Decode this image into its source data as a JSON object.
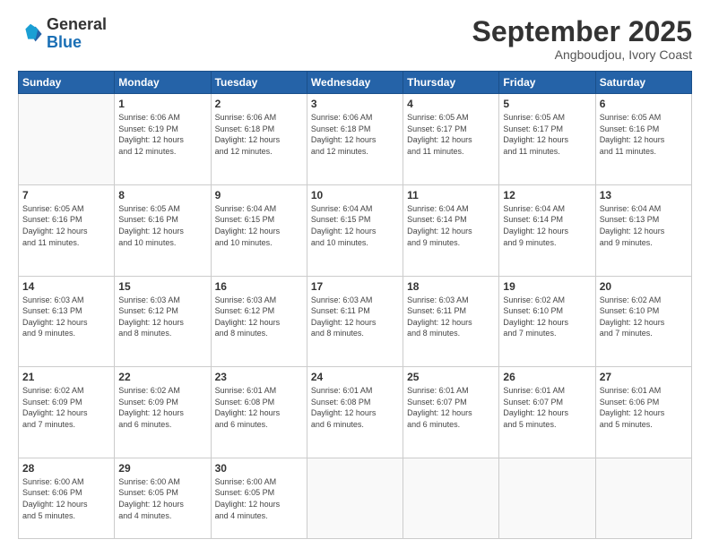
{
  "logo": {
    "general": "General",
    "blue": "Blue"
  },
  "header": {
    "month": "September 2025",
    "location": "Angboudjou, Ivory Coast"
  },
  "weekdays": [
    "Sunday",
    "Monday",
    "Tuesday",
    "Wednesday",
    "Thursday",
    "Friday",
    "Saturday"
  ],
  "weeks": [
    [
      {
        "day": "",
        "info": ""
      },
      {
        "day": "1",
        "info": "Sunrise: 6:06 AM\nSunset: 6:19 PM\nDaylight: 12 hours\nand 12 minutes."
      },
      {
        "day": "2",
        "info": "Sunrise: 6:06 AM\nSunset: 6:18 PM\nDaylight: 12 hours\nand 12 minutes."
      },
      {
        "day": "3",
        "info": "Sunrise: 6:06 AM\nSunset: 6:18 PM\nDaylight: 12 hours\nand 12 minutes."
      },
      {
        "day": "4",
        "info": "Sunrise: 6:05 AM\nSunset: 6:17 PM\nDaylight: 12 hours\nand 11 minutes."
      },
      {
        "day": "5",
        "info": "Sunrise: 6:05 AM\nSunset: 6:17 PM\nDaylight: 12 hours\nand 11 minutes."
      },
      {
        "day": "6",
        "info": "Sunrise: 6:05 AM\nSunset: 6:16 PM\nDaylight: 12 hours\nand 11 minutes."
      }
    ],
    [
      {
        "day": "7",
        "info": "Sunrise: 6:05 AM\nSunset: 6:16 PM\nDaylight: 12 hours\nand 11 minutes."
      },
      {
        "day": "8",
        "info": "Sunrise: 6:05 AM\nSunset: 6:16 PM\nDaylight: 12 hours\nand 10 minutes."
      },
      {
        "day": "9",
        "info": "Sunrise: 6:04 AM\nSunset: 6:15 PM\nDaylight: 12 hours\nand 10 minutes."
      },
      {
        "day": "10",
        "info": "Sunrise: 6:04 AM\nSunset: 6:15 PM\nDaylight: 12 hours\nand 10 minutes."
      },
      {
        "day": "11",
        "info": "Sunrise: 6:04 AM\nSunset: 6:14 PM\nDaylight: 12 hours\nand 9 minutes."
      },
      {
        "day": "12",
        "info": "Sunrise: 6:04 AM\nSunset: 6:14 PM\nDaylight: 12 hours\nand 9 minutes."
      },
      {
        "day": "13",
        "info": "Sunrise: 6:04 AM\nSunset: 6:13 PM\nDaylight: 12 hours\nand 9 minutes."
      }
    ],
    [
      {
        "day": "14",
        "info": "Sunrise: 6:03 AM\nSunset: 6:13 PM\nDaylight: 12 hours\nand 9 minutes."
      },
      {
        "day": "15",
        "info": "Sunrise: 6:03 AM\nSunset: 6:12 PM\nDaylight: 12 hours\nand 8 minutes."
      },
      {
        "day": "16",
        "info": "Sunrise: 6:03 AM\nSunset: 6:12 PM\nDaylight: 12 hours\nand 8 minutes."
      },
      {
        "day": "17",
        "info": "Sunrise: 6:03 AM\nSunset: 6:11 PM\nDaylight: 12 hours\nand 8 minutes."
      },
      {
        "day": "18",
        "info": "Sunrise: 6:03 AM\nSunset: 6:11 PM\nDaylight: 12 hours\nand 8 minutes."
      },
      {
        "day": "19",
        "info": "Sunrise: 6:02 AM\nSunset: 6:10 PM\nDaylight: 12 hours\nand 7 minutes."
      },
      {
        "day": "20",
        "info": "Sunrise: 6:02 AM\nSunset: 6:10 PM\nDaylight: 12 hours\nand 7 minutes."
      }
    ],
    [
      {
        "day": "21",
        "info": "Sunrise: 6:02 AM\nSunset: 6:09 PM\nDaylight: 12 hours\nand 7 minutes."
      },
      {
        "day": "22",
        "info": "Sunrise: 6:02 AM\nSunset: 6:09 PM\nDaylight: 12 hours\nand 6 minutes."
      },
      {
        "day": "23",
        "info": "Sunrise: 6:01 AM\nSunset: 6:08 PM\nDaylight: 12 hours\nand 6 minutes."
      },
      {
        "day": "24",
        "info": "Sunrise: 6:01 AM\nSunset: 6:08 PM\nDaylight: 12 hours\nand 6 minutes."
      },
      {
        "day": "25",
        "info": "Sunrise: 6:01 AM\nSunset: 6:07 PM\nDaylight: 12 hours\nand 6 minutes."
      },
      {
        "day": "26",
        "info": "Sunrise: 6:01 AM\nSunset: 6:07 PM\nDaylight: 12 hours\nand 5 minutes."
      },
      {
        "day": "27",
        "info": "Sunrise: 6:01 AM\nSunset: 6:06 PM\nDaylight: 12 hours\nand 5 minutes."
      }
    ],
    [
      {
        "day": "28",
        "info": "Sunrise: 6:00 AM\nSunset: 6:06 PM\nDaylight: 12 hours\nand 5 minutes."
      },
      {
        "day": "29",
        "info": "Sunrise: 6:00 AM\nSunset: 6:05 PM\nDaylight: 12 hours\nand 4 minutes."
      },
      {
        "day": "30",
        "info": "Sunrise: 6:00 AM\nSunset: 6:05 PM\nDaylight: 12 hours\nand 4 minutes."
      },
      {
        "day": "",
        "info": ""
      },
      {
        "day": "",
        "info": ""
      },
      {
        "day": "",
        "info": ""
      },
      {
        "day": "",
        "info": ""
      }
    ]
  ]
}
